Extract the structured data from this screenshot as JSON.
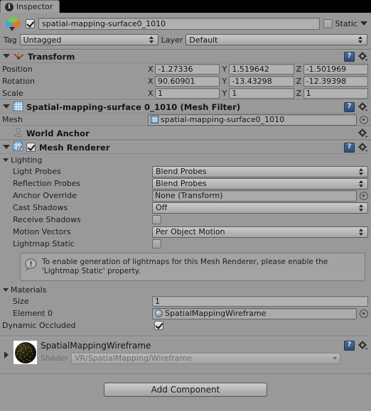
{
  "window": {
    "tab_label": "Inspector",
    "tab_icon": "info-icon"
  },
  "gameobject": {
    "icon": "gameobject-cube-icon",
    "enabled": true,
    "name": "spatial-mapping-surface0_1010",
    "static_label": "Static",
    "static_checked": false,
    "tag_label": "Tag",
    "tag_value": "Untagged",
    "layer_label": "Layer",
    "layer_value": "Default"
  },
  "components": [
    {
      "id": "transform",
      "icon": "transform-axis-icon",
      "title": "Transform",
      "expanded": true,
      "rows": [
        {
          "label": "Position",
          "x": "-1.27336",
          "y": "1.519642",
          "z": "-1.501969"
        },
        {
          "label": "Rotation",
          "x": "90.60901",
          "y": "-13.43298",
          "z": "-12.39398"
        },
        {
          "label": "Scale",
          "x": "1",
          "y": "1",
          "z": "1"
        }
      ],
      "axis_labels": [
        "X",
        "Y",
        "Z"
      ]
    },
    {
      "id": "mesh-filter",
      "icon": "mesh-filter-icon",
      "title": "Spatial-mapping-surface 0_1010 (Mesh Filter)",
      "expanded": true,
      "mesh_label": "Mesh",
      "mesh_value": "spatial-mapping-surface0_1010"
    },
    {
      "id": "world-anchor",
      "icon": "world-anchor-icon",
      "title": "World Anchor",
      "expanded": false
    },
    {
      "id": "mesh-renderer",
      "icon": "mesh-renderer-icon",
      "title": "Mesh Renderer",
      "expanded": true,
      "enabled": true
    }
  ],
  "lighting": {
    "heading": "Lighting",
    "expanded": true,
    "light_probes_label": "Light Probes",
    "light_probes_value": "Blend Probes",
    "reflection_probes_label": "Reflection Probes",
    "reflection_probes_value": "Blend Probes",
    "anchor_override_label": "Anchor Override",
    "anchor_override_value": "None (Transform)",
    "cast_shadows_label": "Cast Shadows",
    "cast_shadows_value": "Off",
    "receive_shadows_label": "Receive Shadows",
    "receive_shadows_checked": false,
    "motion_vectors_label": "Motion Vectors",
    "motion_vectors_value": "Per Object Motion",
    "lightmap_static_label": "Lightmap Static",
    "lightmap_static_checked": false
  },
  "helpbox": {
    "icon": "warning-icon",
    "text": "To enable generation of lightmaps for this Mesh Renderer, please enable the 'Lightmap Static' property."
  },
  "materials": {
    "heading": "Materials",
    "expanded": true,
    "size_label": "Size",
    "size_value": "1",
    "element0_label": "Element 0",
    "element0_value": "SpatialMappingWireframe",
    "dynamic_occluded_label": "Dynamic Occluded",
    "dynamic_occluded_checked": true
  },
  "material_asset": {
    "name": "SpatialMappingWireframe",
    "shader_label": "Shader",
    "shader_value": "VR/SpatialMapping/Wireframe",
    "preview_icon": "material-sphere-preview"
  },
  "footer": {
    "add_component_label": "Add Component"
  },
  "colors": {
    "background": "#999999",
    "tabbar": "#000000",
    "field": "#b0b0b0",
    "help_icon_blue": "#3a5c87",
    "text": "#1a1a1a",
    "disabled_text": "#6e6e6e"
  }
}
